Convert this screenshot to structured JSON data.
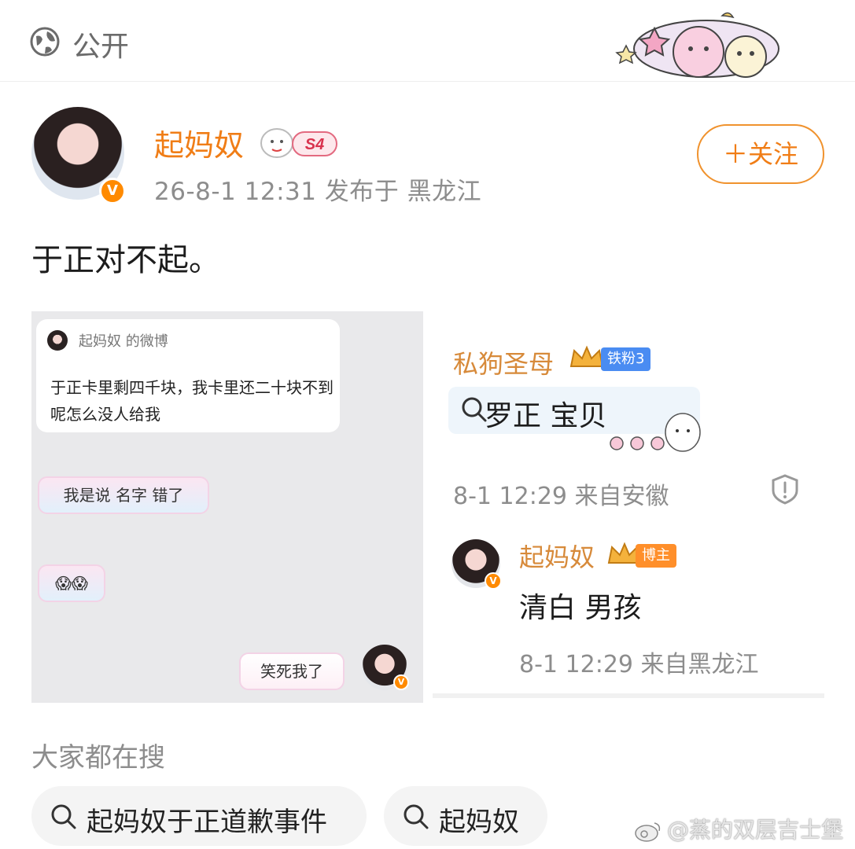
{
  "header": {
    "visibility_label": "公开",
    "visibility_icon": "globe-icon",
    "decoration_icon": "cute-cat-sticker-icon"
  },
  "post": {
    "author": "起妈奴",
    "level_badge": "S4",
    "verified_mark": "V",
    "meta": "26-8-1 12:31  发布于 黑龙江",
    "follow_label": "＋关注",
    "text": "于正对不起。",
    "accent_color": "#f07d16"
  },
  "image_left": {
    "card_title": "起妈奴 的微博",
    "card_body": "于正卡里剩四千块，我卡里还二十块不到呢怎么没人给我",
    "bubble_1": "我是说 名字 错了",
    "bubble_2": "😱😱",
    "bubble_3": "笑死我了",
    "verified_mark": "V"
  },
  "image_right": {
    "comment_1": {
      "name": "私狗圣母",
      "badge": "铁粉3",
      "text": "罗正  宝贝",
      "meta": "8-1 12:29  来自安徽"
    },
    "comment_2": {
      "name": "起妈奴",
      "badge": "博主",
      "text": "清白 男孩",
      "meta": "8-1 12:29  来自黑龙江",
      "verified_mark": "V"
    }
  },
  "trending": {
    "title": "大家都在搜",
    "chips": [
      "起妈奴于正道歉事件",
      "起妈奴"
    ]
  },
  "watermark": "@蒸的双层吉士堡"
}
